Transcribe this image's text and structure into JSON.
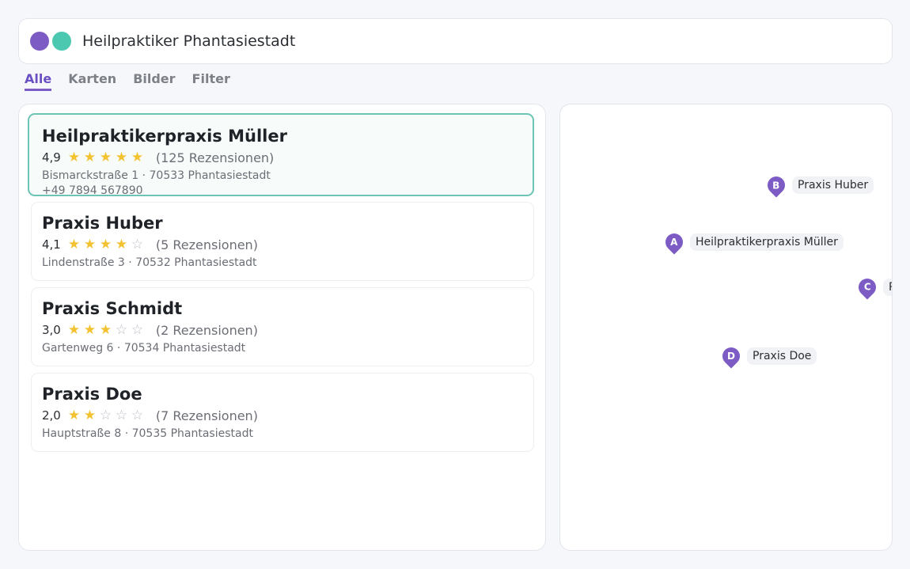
{
  "search": {
    "query": "Heilpraktiker Phantasiestadt",
    "dot_colors": [
      "#7c5cc4",
      "#4cc8b0"
    ]
  },
  "tabs": [
    {
      "label": "Alle",
      "active": true
    },
    {
      "label": "Karten",
      "active": false
    },
    {
      "label": "Bilder",
      "active": false
    },
    {
      "label": "Filter",
      "active": false
    }
  ],
  "results": [
    {
      "name": "Heilpraktikerpraxis Müller",
      "rating": "4,9",
      "stars_full": 5,
      "reviews": "(125 Rezensionen)",
      "address": "Bismarckstraße 1 · 70533 Phantasiestadt",
      "phone": "+49 7894 567890"
    },
    {
      "name": "Praxis Huber",
      "rating": "4,1",
      "stars_full": 4,
      "reviews": "(5 Rezensionen)",
      "address": "Lindenstraße 3 · 70532 Phantasiestadt"
    },
    {
      "name": "Praxis Schmidt",
      "rating": "3,0",
      "stars_full": 3,
      "reviews": "(2 Rezensionen)",
      "address": "Gartenweg 6 · 70534 Phantasiestadt"
    },
    {
      "name": "Praxis Doe",
      "rating": "2,0",
      "stars_full": 2,
      "reviews": "(7 Rezensionen)",
      "address": "Hauptstraße 8 · 70535 Phantasiestadt"
    }
  ],
  "map": {
    "markers": [
      {
        "letter": "A",
        "label": "Heilpraktikerpraxis Müller"
      },
      {
        "letter": "B",
        "label": "Praxis Huber"
      },
      {
        "letter": "C",
        "label": "Prax"
      },
      {
        "letter": "D",
        "label": "Praxis Doe"
      }
    ],
    "pin_color": "#7c5cc4"
  },
  "colors": {
    "accent": "#7c5cc4",
    "selected_border": "#6cc4b4",
    "star": "#f2c230"
  }
}
